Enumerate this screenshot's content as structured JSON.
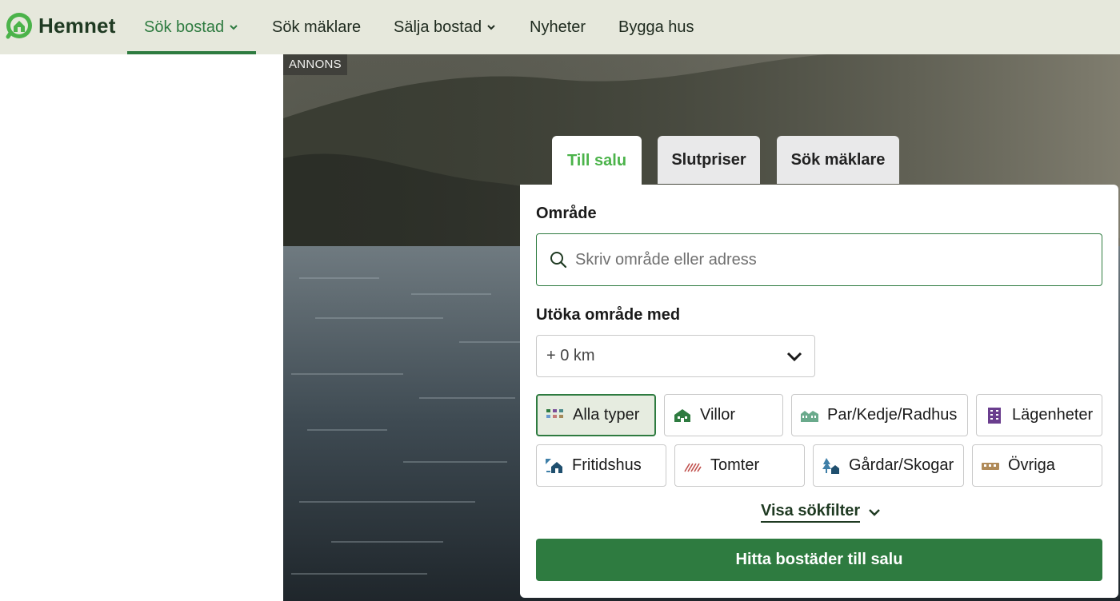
{
  "brand": {
    "name": "Hemnet",
    "accent": "#2e7b40",
    "tab_active_color": "#4bb34a"
  },
  "nav": {
    "items": [
      {
        "label": "Sök bostad",
        "has_dropdown": true,
        "active": true
      },
      {
        "label": "Sök mäklare",
        "has_dropdown": false
      },
      {
        "label": "Sälja bostad",
        "has_dropdown": true
      },
      {
        "label": "Nyheter",
        "has_dropdown": false
      },
      {
        "label": "Bygga hus",
        "has_dropdown": false
      }
    ]
  },
  "ad": {
    "badge": "ANNONS"
  },
  "tabs": [
    {
      "label": "Till salu",
      "active": true
    },
    {
      "label": "Slutpriser",
      "active": false
    },
    {
      "label": "Sök mäklare",
      "active": false
    }
  ],
  "search": {
    "area_label": "Område",
    "placeholder": "Skriv område eller adress",
    "icon": "search-icon",
    "expand_label": "Utöka område med",
    "expand_value": "+ 0 km"
  },
  "types": [
    {
      "label": "Alla typer",
      "icon": "grid-icon",
      "selected": true
    },
    {
      "label": "Villor",
      "icon": "villa-icon"
    },
    {
      "label": "Par/Kedje/Radhus",
      "icon": "townhouse-icon"
    },
    {
      "label": "Lägenheter",
      "icon": "apartment-icon"
    },
    {
      "label": "Fritidshus",
      "icon": "cottage-icon"
    },
    {
      "label": "Tomter",
      "icon": "plot-icon"
    },
    {
      "label": "Gårdar/Skogar",
      "icon": "farm-forest-icon"
    },
    {
      "label": "Övriga",
      "icon": "other-icon"
    }
  ],
  "filters_link": "Visa sökfilter",
  "cta": "Hitta bostäder till salu"
}
